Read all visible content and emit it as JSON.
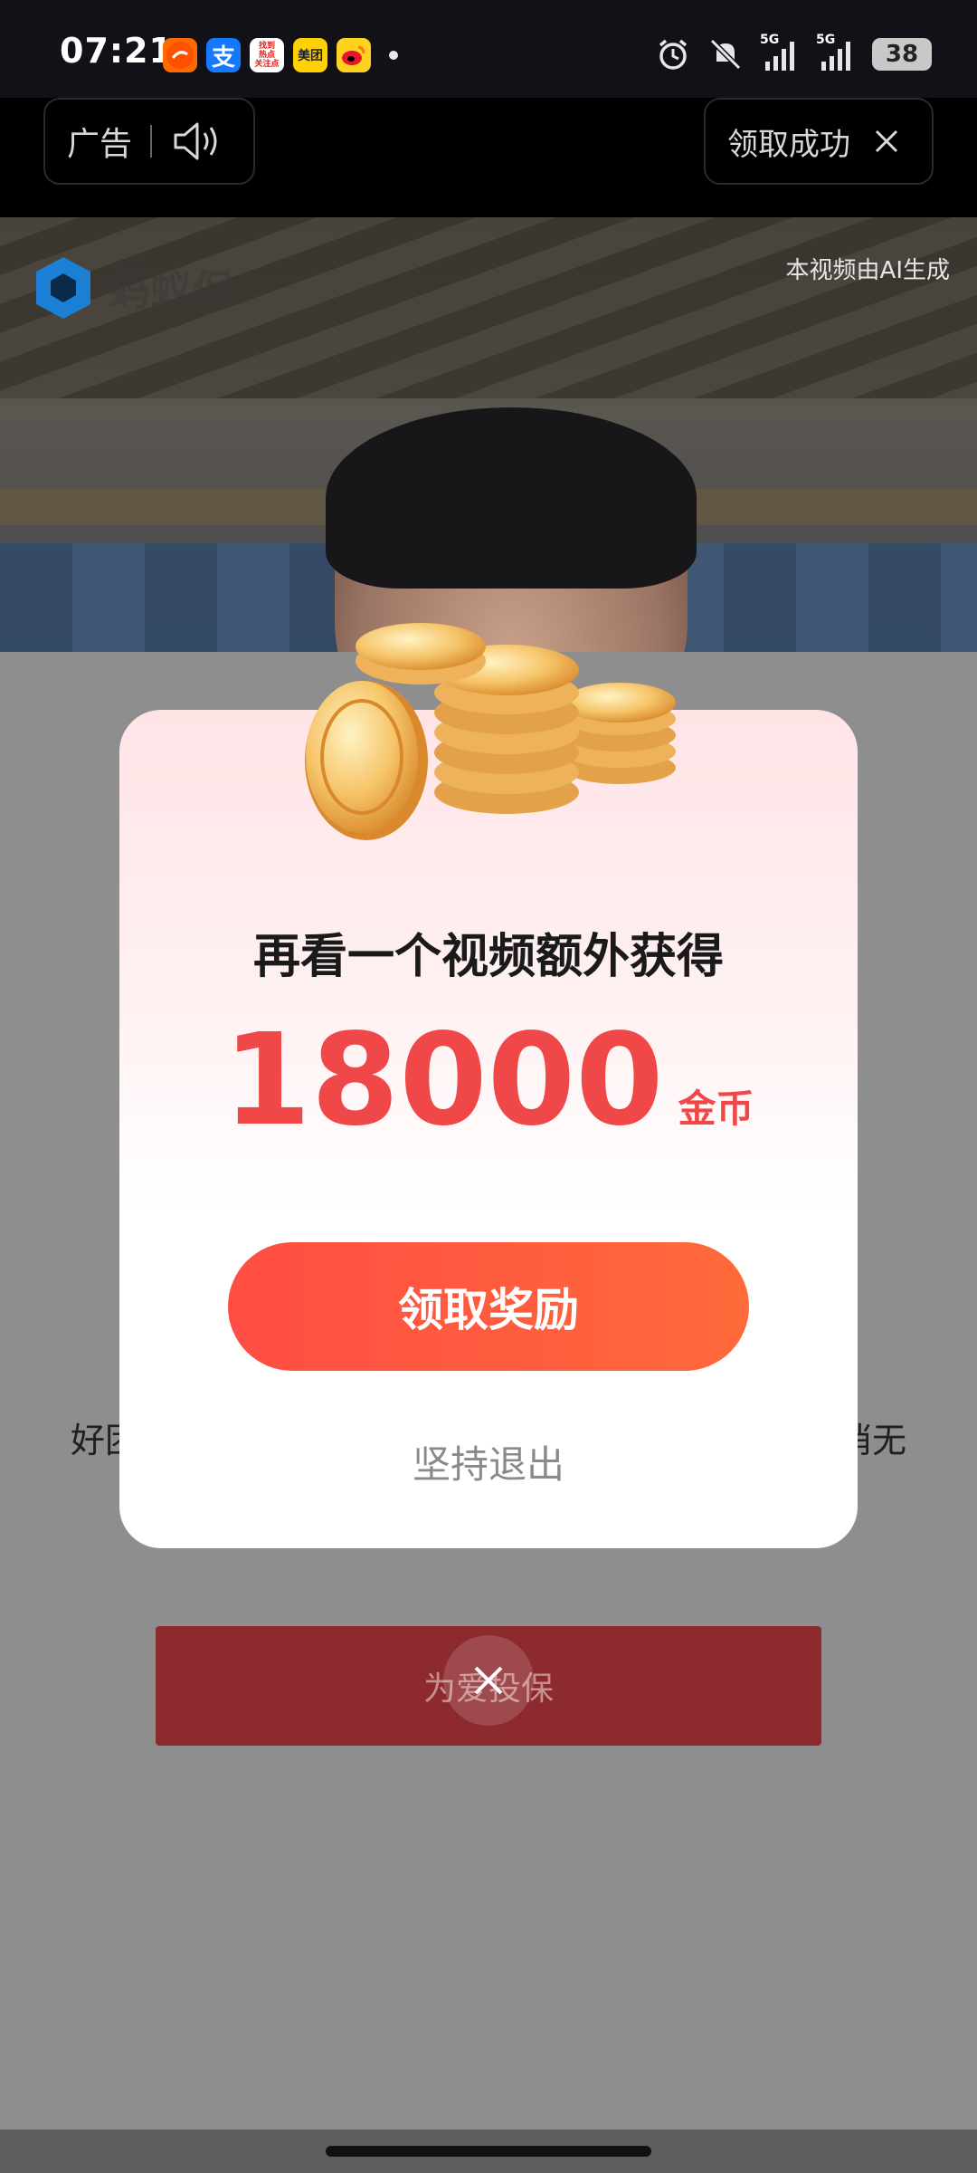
{
  "status_bar": {
    "time": "07:21",
    "app_icons": [
      "taobao-icon",
      "alipay-icon",
      "news-app-icon",
      "meituan-icon",
      "weibo-icon"
    ],
    "alipay_glyph": "支",
    "news_app_lines": [
      "找到",
      "热点",
      "关注点"
    ],
    "meituan_label": "美团",
    "network_1": "5G",
    "network_2": "5G",
    "battery": "38"
  },
  "ad_bar": {
    "ad_label": "广告",
    "reward_label": "领取成功"
  },
  "video": {
    "logo_text": "蚂蚁保",
    "ai_note": "本视频由AI生成"
  },
  "background": {
    "text_left": "好团",
    "text_right": "消无",
    "button_label": "为爱投保"
  },
  "dialog": {
    "title": "再看一个视频额外获得",
    "amount": "18000",
    "unit": "金币",
    "claim_button": "领取奖励",
    "exit_link": "坚持退出"
  },
  "colors": {
    "accent_red": "#f04848",
    "button_gradient_start": "#ff4d44",
    "button_gradient_end": "#ff6a3a",
    "bg_button": "#8c2a2e"
  }
}
